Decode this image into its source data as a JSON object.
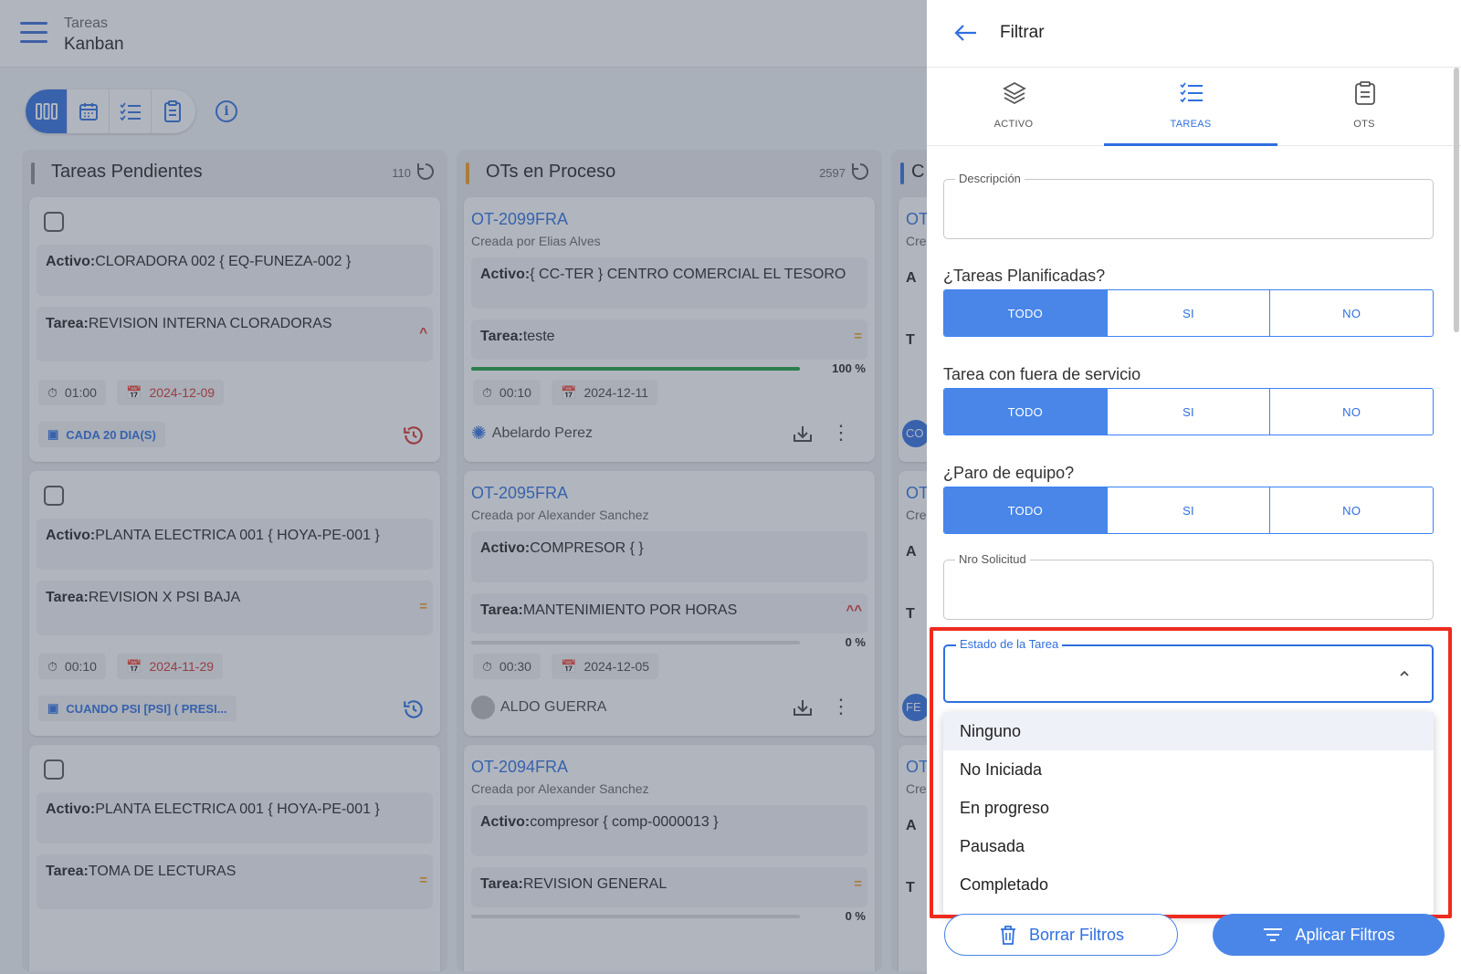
{
  "app": {
    "section": "Tareas",
    "view": "Kanban"
  },
  "columns": [
    {
      "title": "Tareas Pendientes",
      "count": "110",
      "color": "#8a8a8a"
    },
    {
      "title": "OTs en Proceso",
      "count": "2597",
      "color": "#f39c1f"
    },
    {
      "title": "C",
      "color": "#2f6fe0"
    }
  ],
  "pending_cards": [
    {
      "activo_label": "Activo:",
      "activo": "CLORADORA 002 { EQ-FUNEZA-002 }",
      "tarea_label": "Tarea:",
      "tarea": "REVISION INTERNA CLORADORAS",
      "priority": "^",
      "time": "01:00",
      "date": "2024-12-09",
      "recurrence": "CADA 20 DIA(S)"
    },
    {
      "activo_label": "Activo:",
      "activo": "PLANTA ELECTRICA 001 { HOYA-PE-001 }",
      "tarea_label": "Tarea:",
      "tarea": "REVISION X PSI BAJA",
      "priority": "=",
      "time": "00:10",
      "date": "2024-11-29",
      "recurrence": "CUANDO PSI [PSI] ( PRESI..."
    },
    {
      "activo_label": "Activo:",
      "activo": "PLANTA ELECTRICA 001 { HOYA-PE-001 }",
      "tarea_label": "Tarea:",
      "tarea": "TOMA DE LECTURAS",
      "priority": "="
    }
  ],
  "ot_cards": [
    {
      "code": "OT-2099FRA",
      "created": "Creada por Elias Alves",
      "activo_label": "Activo:",
      "activo": "{ CC-TER } CENTRO COMERCIAL EL TESORO",
      "tarea_label": "Tarea:",
      "tarea": "teste",
      "priority": "=",
      "progress": "100 %",
      "progress_value": 100,
      "time": "00:10",
      "date": "2024-12-11",
      "person": "Abelardo Perez"
    },
    {
      "code": "OT-2095FRA",
      "created": "Creada por Alexander Sanchez",
      "activo_label": "Activo:",
      "activo": "COMPRESOR { }",
      "tarea_label": "Tarea:",
      "tarea": "MANTENIMIENTO POR HORAS",
      "priority": "^^",
      "progress": "0 %",
      "progress_value": 0,
      "time": "00:30",
      "date": "2024-12-05",
      "person": "ALDO GUERRA"
    },
    {
      "code": "OT-2094FRA",
      "created": "Creada por Alexander Sanchez",
      "activo_label": "Activo:",
      "activo": "compresor { comp-0000013 }",
      "tarea_label": "Tarea:",
      "tarea": "REVISION GENERAL",
      "priority": "=",
      "progress": "0 %",
      "progress_value": 0
    }
  ],
  "third_col_fragments": [
    "OT",
    "Cre",
    "A",
    "T",
    "CO",
    "OT",
    "Cre",
    "A",
    "T",
    "FE",
    "OT",
    "Cre",
    "A",
    "T"
  ],
  "filter": {
    "title": "Filtrar",
    "tabs": [
      "ACTIVO",
      "TAREAS",
      "OTS"
    ],
    "descripcion_label": "Descripción",
    "planificadas_label": "¿Tareas Planificadas?",
    "fuera_servicio_label": "Tarea con fuera de servicio",
    "paro_label": "¿Paro de equipo?",
    "seg_options": [
      "TODO",
      "SI",
      "NO"
    ],
    "nro_solicitud_label": "Nro Solicitud",
    "estado_label": "Estado de la Tarea",
    "estado_options": [
      "Ninguno",
      "No Iniciada",
      "En progreso",
      "Pausada",
      "Completado"
    ],
    "clear_button": "Borrar Filtros",
    "apply_button": "Aplicar Filtros"
  },
  "colors": {
    "accent": "#2f6fe0",
    "highlight_box": "#ee2b1f",
    "overdue": "#d83030"
  }
}
